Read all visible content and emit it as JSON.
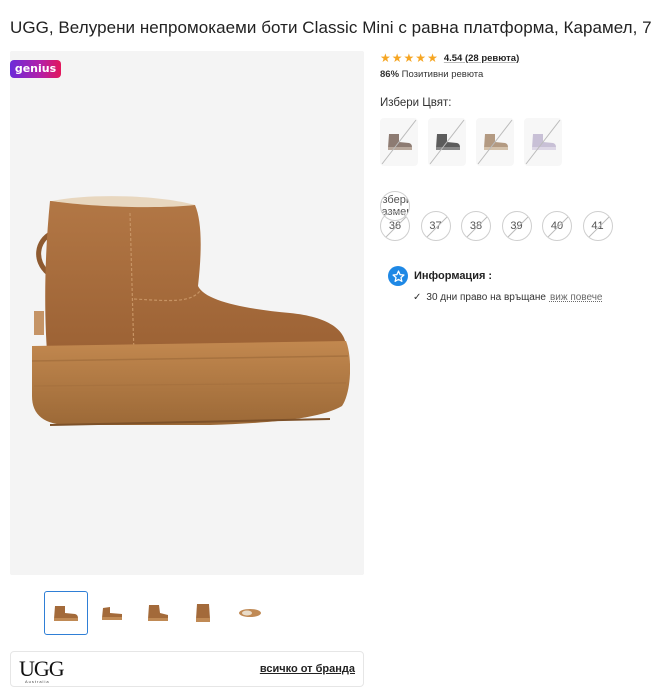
{
  "product": {
    "title": "UGG, Велурени непромокаеми боти Classic Mini с равна платформа, Карамел, 7"
  },
  "gallery": {
    "badge": "genius",
    "thumbnails": [
      "boot-side-view",
      "boot-front-view",
      "boot-angle-view",
      "boot-back-view",
      "boot-sole-view"
    ],
    "active_thumbnail": 0
  },
  "brand": {
    "logo_text": "UGG",
    "logo_subtext": "Australia",
    "link_label": "всичко от бранда"
  },
  "rating": {
    "value": "4.54",
    "reviews": "(28 ревюта)",
    "stars": 4.5,
    "positive_pct": "86%",
    "positive_label": "Позитивни ревюта"
  },
  "color": {
    "label": "Избери Цвят:",
    "options": [
      {
        "name": "taupe",
        "hex": "#8d7b72"
      },
      {
        "name": "charcoal",
        "hex": "#5c5c5c"
      },
      {
        "name": "sand",
        "hex": "#b39a82"
      },
      {
        "name": "lavender",
        "hex": "#c8c0d6"
      }
    ]
  },
  "size": {
    "label": "Избери Размер:",
    "options": [
      "36",
      "37",
      "38",
      "39",
      "40",
      "41"
    ]
  },
  "info": {
    "title": "Информация :",
    "return_text": "30 дни право на връщане",
    "more_link": "виж повече"
  },
  "colors": {
    "accent": "#1e88e5",
    "star": "#f6a623",
    "product": "#a36a3a"
  }
}
